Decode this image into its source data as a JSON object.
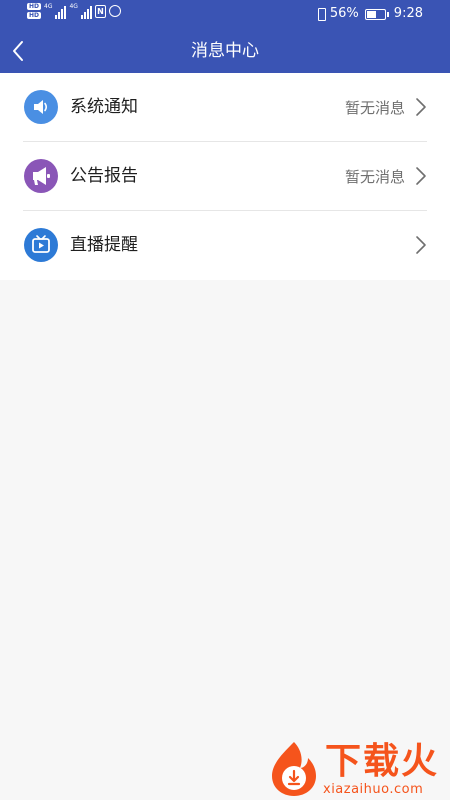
{
  "status_bar": {
    "battery_percent": "56%",
    "time": "9:28",
    "battery_level": 0.56,
    "hd_badge": "HD",
    "network_label": "4G"
  },
  "header": {
    "title": "消息中心"
  },
  "messages": [
    {
      "label": "系统通知",
      "status": "暂无消息",
      "icon": "speaker-icon",
      "color": "#4a8fe3"
    },
    {
      "label": "公告报告",
      "status": "暂无消息",
      "icon": "megaphone-icon",
      "color": "#8a56b7"
    },
    {
      "label": "直播提醒",
      "status": "",
      "icon": "tv-icon",
      "color": "#2d7ad6"
    }
  ],
  "watermark": {
    "title": "下载火",
    "url": "xiazaihuo.com",
    "color": "#f5541c"
  },
  "colors": {
    "primary": "#3a54b4",
    "background": "#f7f7f7"
  }
}
